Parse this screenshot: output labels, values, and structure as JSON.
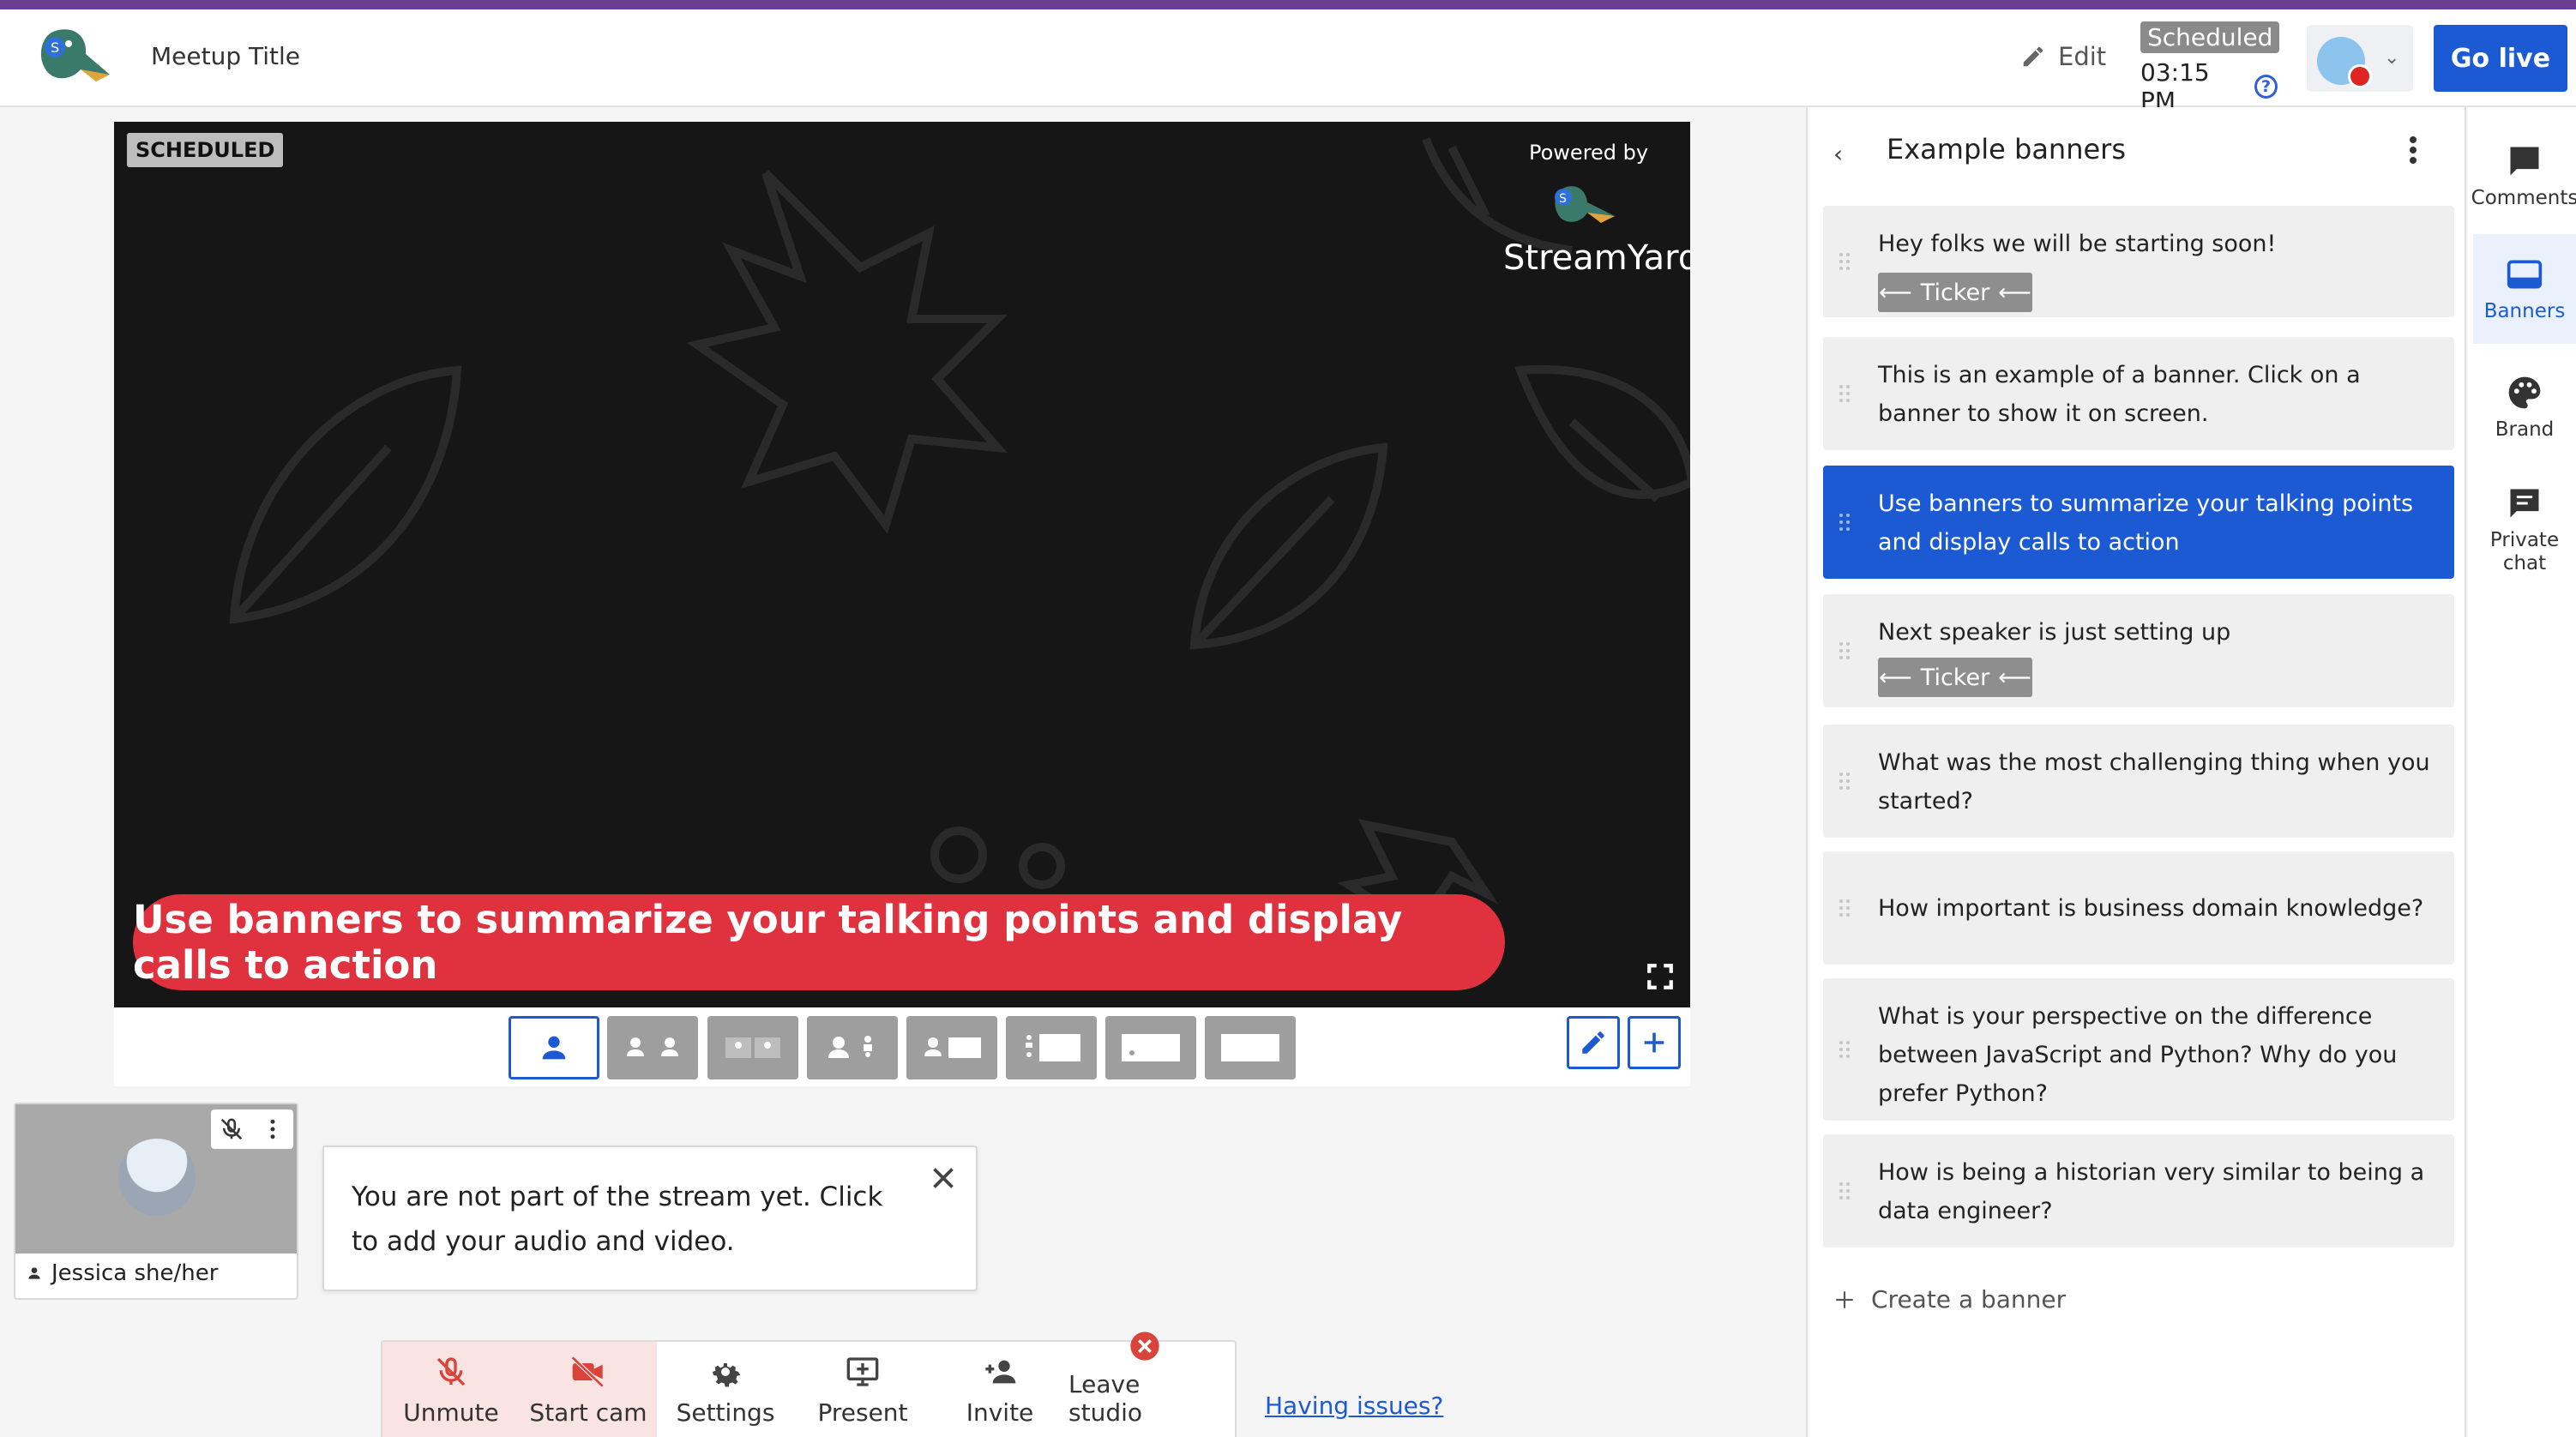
{
  "header": {
    "meetup_title": "Meetup Title",
    "edit_label": "Edit",
    "status_badge": "Scheduled",
    "scheduled_time": "03:15 PM",
    "go_live_label": "Go live"
  },
  "stage": {
    "status_label": "SCHEDULED",
    "powered_by": "Powered by",
    "brand_name": "StreamYard",
    "banner_text": "Use banners to summarize your talking points and display calls to action"
  },
  "participant": {
    "name": "Jessica she/her"
  },
  "notice": {
    "text": "You are not part of the stream yet. Click to add your audio and video."
  },
  "controls": {
    "unmute": "Unmute",
    "start_cam": "Start cam",
    "settings": "Settings",
    "present": "Present",
    "invite": "Invite",
    "leave": "Leave studio",
    "having_issues": "Having issues?"
  },
  "banners_panel": {
    "title": "Example banners",
    "items": [
      {
        "text": "Hey folks we will be starting soon!",
        "ticker": "Ticker"
      },
      {
        "text": "This is an example of a banner. Click on a banner to show it on screen."
      },
      {
        "text": "Use banners to summarize your talking points and display calls to action",
        "active": true
      },
      {
        "text": "Next speaker is just setting up",
        "ticker": "Ticker"
      },
      {
        "text": "What was the most challenging thing when you started?"
      },
      {
        "text": "How important is business domain knowledge?"
      },
      {
        "text": "What is your perspective on the difference between JavaScript and Python? Why do you prefer Python?"
      },
      {
        "text": "How is being a historian very similar to being a data engineer?"
      }
    ],
    "create_label": "Create a banner"
  },
  "side_tabs": {
    "comments": "Comments",
    "banners": "Banners",
    "brand": "Brand",
    "private_chat": "Private chat"
  },
  "colors": {
    "accent": "#1c5ad3",
    "banner_red": "#e0313f",
    "top_stripe": "#6a3f93"
  }
}
